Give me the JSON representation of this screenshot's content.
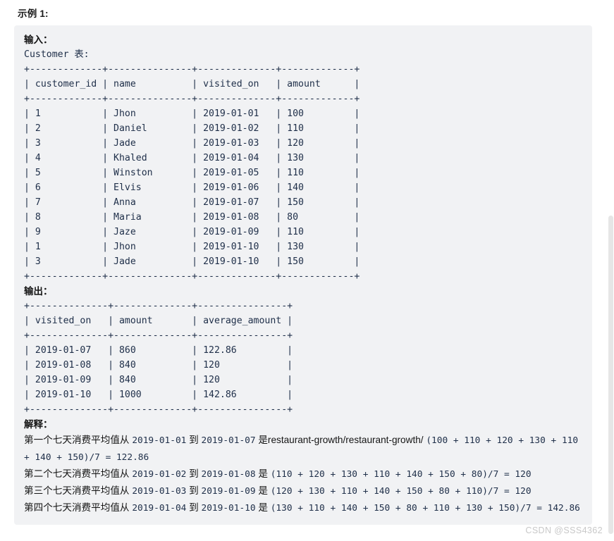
{
  "page": {
    "example_title": "示例 1:",
    "watermark": "CSDN @SSS4362"
  },
  "input_section": {
    "heading": "输入：",
    "table_caption": "Customer 表:",
    "separator": "+-------------+---------------+--------------+-------------+",
    "header_row": "| customer_id | name          | visited_on   | amount      |",
    "rows": [
      "| 1           | Jhon          | 2019-01-01   | 100         |",
      "| 2           | Daniel        | 2019-01-02   | 110         |",
      "| 3           | Jade          | 2019-01-03   | 120         |",
      "| 4           | Khaled        | 2019-01-04   | 130         |",
      "| 5           | Winston       | 2019-01-05   | 110         |",
      "| 6           | Elvis         | 2019-01-06   | 140         |",
      "| 7           | Anna          | 2019-01-07   | 150         |",
      "| 8           | Maria         | 2019-01-08   | 80          |",
      "| 9           | Jaze          | 2019-01-09   | 110         |",
      "| 1           | Jhon          | 2019-01-10   | 130         |",
      "| 3           | Jade          | 2019-01-10   | 150         |"
    ]
  },
  "output_section": {
    "heading": "输出：",
    "separator": "+--------------+--------------+----------------+",
    "header_row": "| visited_on   | amount       | average_amount |",
    "rows": [
      "| 2019-01-07   | 860          | 122.86         |",
      "| 2019-01-08   | 840          | 120            |",
      "| 2019-01-09   | 840          | 120            |",
      "| 2019-01-10   | 1000         | 142.86         |"
    ]
  },
  "explanation_section": {
    "heading": "解释：",
    "lines": [
      {
        "prefix": "第一个七天消费平均值从 ",
        "date_from": "2019-01-01",
        "mid": " 到 ",
        "date_to": "2019-01-07",
        "suffix_text": " 是restaurant-growth/restaurant-growth/ ",
        "formula": "(100 + 110 + 120 + 130 + 110 + 140 + 150)/7 = 122.86"
      },
      {
        "prefix": "第二个七天消费平均值从 ",
        "date_from": "2019-01-02",
        "mid": " 到 ",
        "date_to": "2019-01-08",
        "suffix_text": " 是 ",
        "formula": "(110 + 120 + 130 + 110 + 140 + 150 + 80)/7 = 120"
      },
      {
        "prefix": "第三个七天消费平均值从 ",
        "date_from": "2019-01-03",
        "mid": " 到 ",
        "date_to": "2019-01-09",
        "suffix_text": " 是 ",
        "formula": "(120 + 130 + 110 + 140 + 150 + 80 + 110)/7 = 120"
      },
      {
        "prefix": "第四个七天消费平均值从 ",
        "date_from": "2019-01-04",
        "mid": " 到 ",
        "date_to": "2019-01-10",
        "suffix_text": " 是 ",
        "formula": "(130 + 110 + 140 + 150 + 80 + 110 + 130 + 150)/7 = 142.86"
      }
    ]
  },
  "scrollbar": {
    "present": true
  },
  "colors": {
    "block_background": "#f1f2f4",
    "page_background": "#ffffff",
    "mono_text": "#20304a",
    "pipe": "#6b5a3e",
    "heading_text": "#141414",
    "watermark": "#c8c8c8",
    "scrollbar_thumb": "#e6e6e6"
  }
}
